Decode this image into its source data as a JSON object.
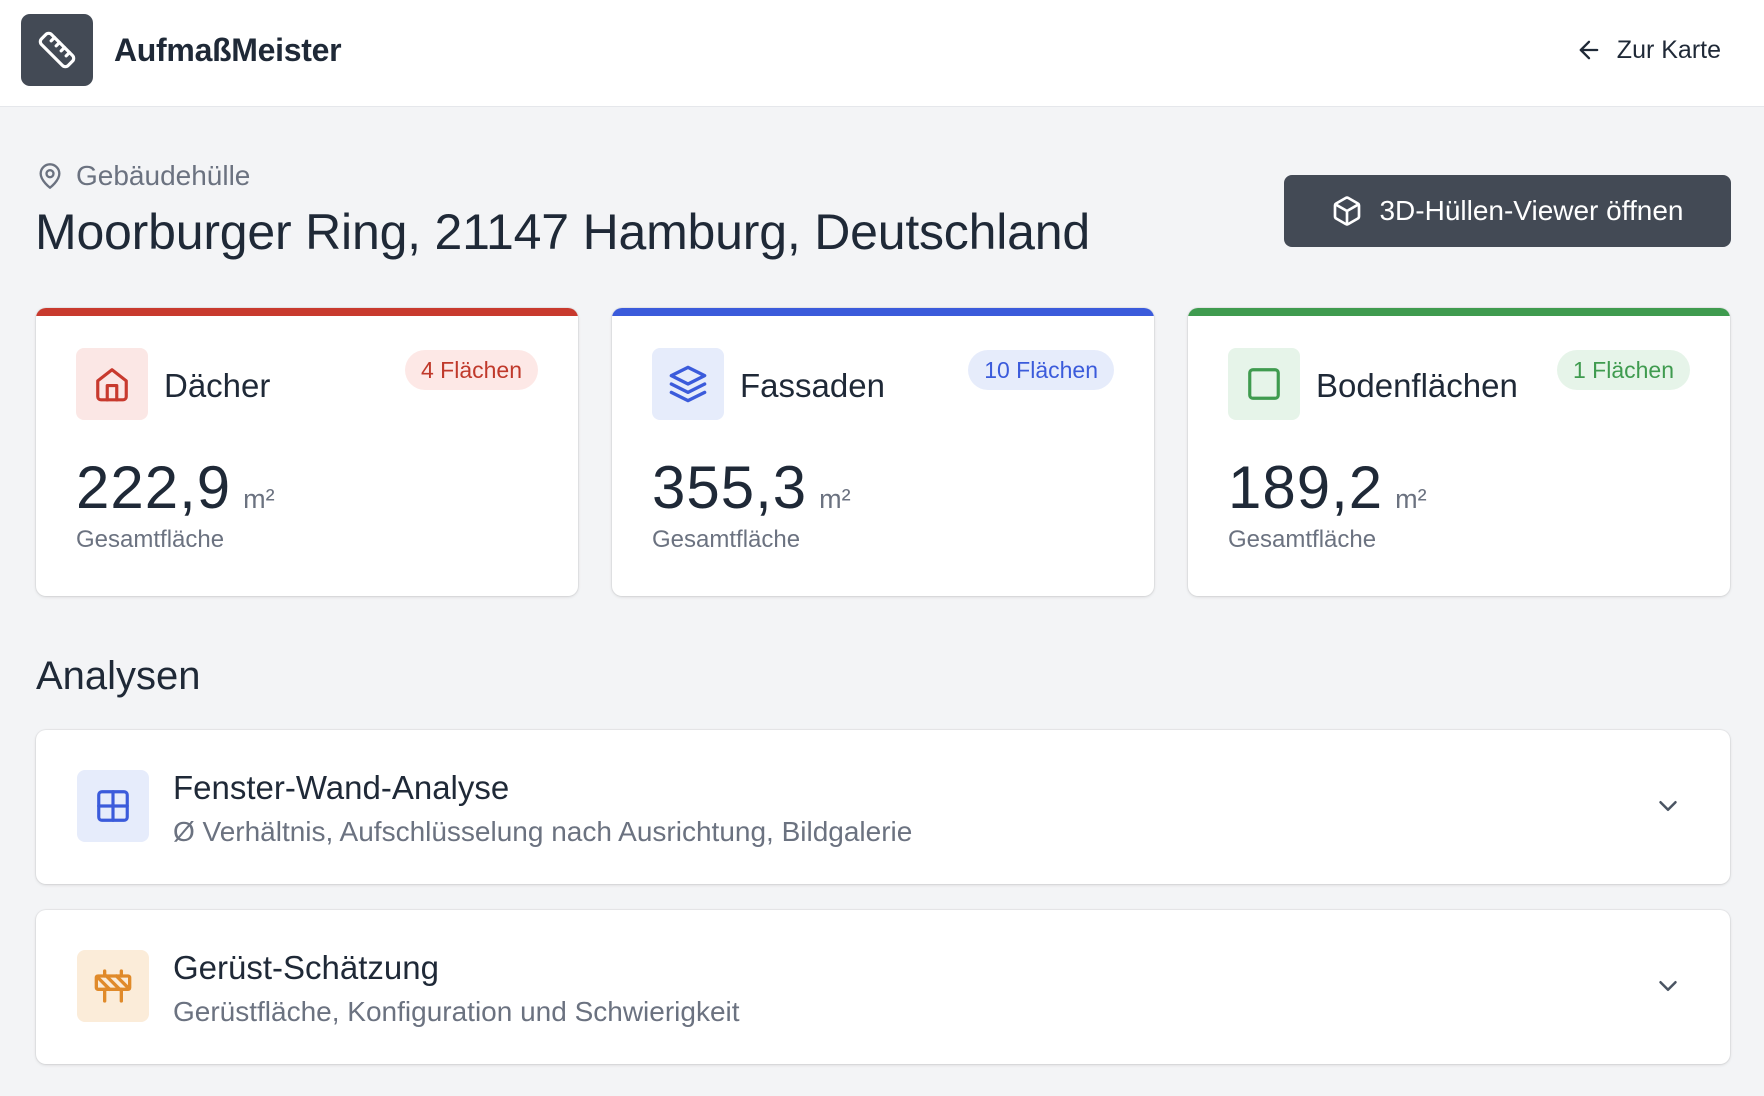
{
  "header": {
    "app_name": "AufmaßMeister",
    "back_label": "Zur Karte"
  },
  "page": {
    "breadcrumb": "Gebäudehülle",
    "title": "Moorburger Ring, 21147 Hamburg, Deutschland",
    "viewer_button": "3D-Hüllen-Viewer öffnen"
  },
  "cards": [
    {
      "title": "Dächer",
      "badge": "4 Flächen",
      "value": "222,9",
      "unit": "m²",
      "label": "Gesamtfläche",
      "icon": "home-icon",
      "accent": "#c83a2e",
      "icon_bg": "#fbe7e5",
      "badge_bg": "#fde8e6",
      "badge_fg": "#c0392b"
    },
    {
      "title": "Fassaden",
      "badge": "10 Flächen",
      "value": "355,3",
      "unit": "m²",
      "label": "Gesamtfläche",
      "icon": "layers-icon",
      "accent": "#3b5bdb",
      "icon_bg": "#e6ecfb",
      "badge_bg": "#e6ecfb",
      "badge_fg": "#3b5bdb"
    },
    {
      "title": "Bodenflächen",
      "badge": "1 Flächen",
      "value": "189,2",
      "unit": "m²",
      "label": "Gesamtfläche",
      "icon": "square-icon",
      "accent": "#3f9b4f",
      "icon_bg": "#e6f4e9",
      "badge_bg": "#e6f4e9",
      "badge_fg": "#3f9b4f"
    }
  ],
  "analyses": {
    "section_title": "Analysen",
    "items": [
      {
        "title": "Fenster-Wand-Analyse",
        "subtitle": "Ø Verhältnis, Aufschlüsselung nach Ausrichtung, Bildgalerie",
        "icon": "window-grid-icon",
        "icon_bg": "#e6ecfb",
        "icon_fg": "#3b5bdb"
      },
      {
        "title": "Gerüst-Schätzung",
        "subtitle": "Gerüstfläche, Konfiguration und Schwierigkeit",
        "icon": "barrier-icon",
        "icon_bg": "#fbecd9",
        "icon_fg": "#e08a2a"
      }
    ]
  }
}
